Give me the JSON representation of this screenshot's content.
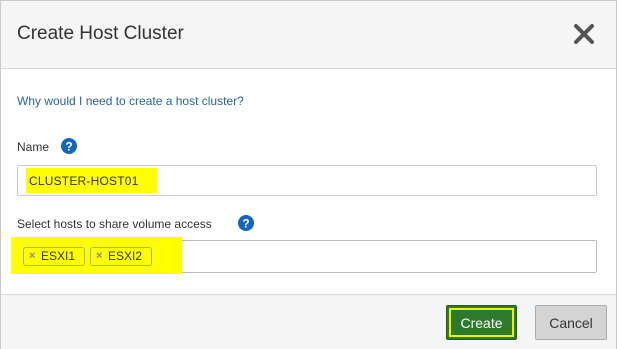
{
  "dialog": {
    "title": "Create Host Cluster",
    "close_icon": "close-x-icon",
    "help_link": "Why would I need to create a host cluster?"
  },
  "name_field": {
    "label": "Name",
    "help_icon": "question-circle-icon",
    "value": "CLUSTER-HOST01"
  },
  "hosts_field": {
    "label": "Select hosts to share volume access",
    "help_icon": "question-circle-icon",
    "tags": [
      {
        "label": "ESXI1",
        "remove_icon": "remove-x-icon"
      },
      {
        "label": "ESXI2",
        "remove_icon": "remove-x-icon"
      }
    ]
  },
  "footer": {
    "create_label": "Create",
    "cancel_label": "Cancel"
  },
  "colors": {
    "highlight": "#ffff00",
    "create_button": "#2d7a2d",
    "link": "#2a6496",
    "help_icon": "#1565c0"
  }
}
